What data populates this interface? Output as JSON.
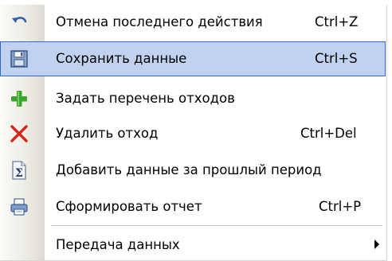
{
  "menu": {
    "items": [
      {
        "label": "Отмена последнего действия",
        "shortcut": "Ctrl+Z",
        "icon": "undo-icon",
        "highlighted": false
      },
      {
        "label": "Сохранить данные",
        "shortcut": "Ctrl+S",
        "icon": "save-icon",
        "highlighted": true
      },
      {
        "label": "Задать перечень отходов",
        "shortcut": "",
        "icon": "add-icon",
        "highlighted": false
      },
      {
        "label": "Удалить отход",
        "shortcut": "Ctrl+Del",
        "icon": "delete-icon",
        "highlighted": false
      },
      {
        "label": "Добавить данные за прошлый период",
        "shortcut": "",
        "icon": "sum-icon",
        "highlighted": false
      },
      {
        "label": "Сформировать отчет",
        "shortcut": "Ctrl+P",
        "icon": "print-icon",
        "highlighted": false
      },
      {
        "label": "Передача данных",
        "shortcut": "",
        "icon": "",
        "highlighted": false,
        "has_submenu": true
      }
    ]
  },
  "colors": {
    "highlight_fill": "#c1d2ee",
    "highlight_border": "#316ac5",
    "add_green": "#3aa52a",
    "delete_red": "#d8261b"
  }
}
